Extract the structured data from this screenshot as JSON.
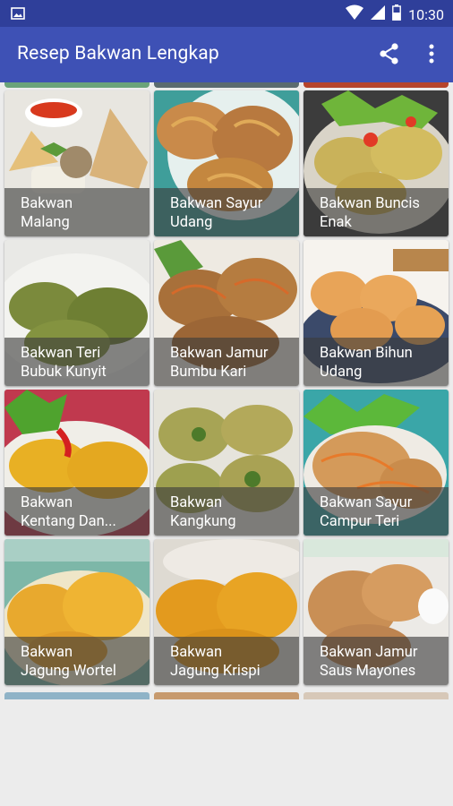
{
  "status_bar": {
    "time": "10:30",
    "icons": [
      "image-notification-icon",
      "wifi-icon",
      "signal-icon",
      "battery-icon"
    ]
  },
  "app_bar": {
    "title": "Resep Bakwan Lengkap",
    "actions": [
      "share-icon",
      "more-vert-icon"
    ]
  },
  "colors": {
    "status_bar": "#2f3f9a",
    "app_bar": "#3e51b5",
    "background": "#ececec",
    "caption_overlay": "rgba(60,60,60,0.62)"
  },
  "recipes": [
    {
      "name": "Bakwan\nMalang"
    },
    {
      "name": "Bakwan Sayur\nUdang"
    },
    {
      "name": "Bakwan Buncis\nEnak"
    },
    {
      "name": "Bakwan Teri\nBubuk Kunyit"
    },
    {
      "name": "Bakwan Jamur\nBumbu Kari"
    },
    {
      "name": "Bakwan Bihun\nUdang"
    },
    {
      "name": "Bakwan\nKentang Dan..."
    },
    {
      "name": "Bakwan\nKangkung"
    },
    {
      "name": "Bakwan Sayur\nCampur Teri"
    },
    {
      "name": "Bakwan\nJagung Wortel"
    },
    {
      "name": "Bakwan\nJagung Krispi"
    },
    {
      "name": "Bakwan Jamur\nSaus Mayones"
    }
  ]
}
